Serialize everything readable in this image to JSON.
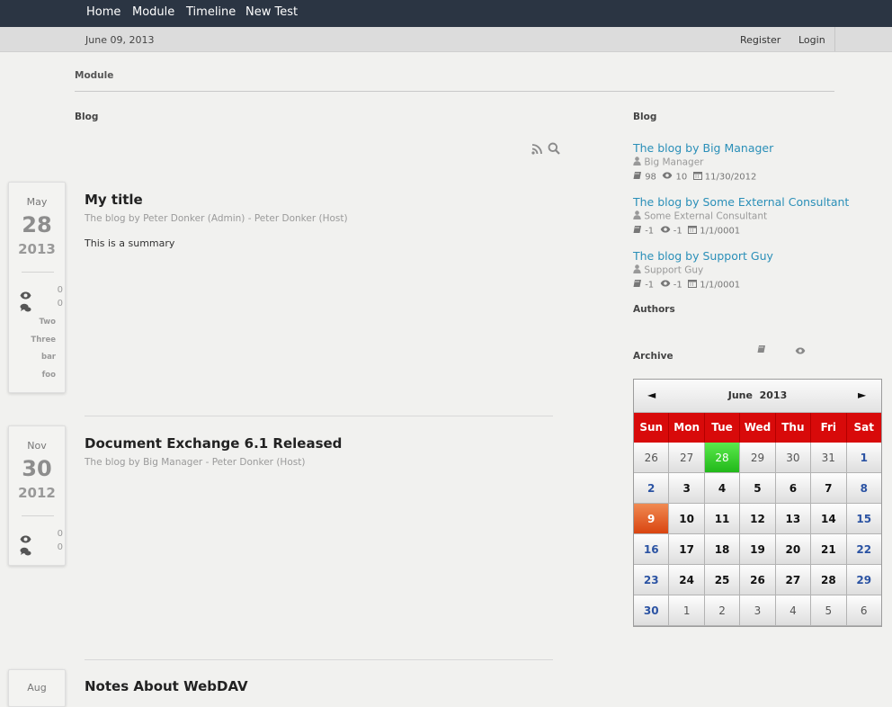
{
  "topnav": {
    "items": [
      "Home",
      "Module",
      "Timeline",
      "New Test"
    ]
  },
  "subbar": {
    "date": "June 09, 2013",
    "register": "Register",
    "login": "Login"
  },
  "breadcrumb": "Module",
  "main": {
    "section_title": "Blog",
    "posts": [
      {
        "month": "May",
        "day": "28",
        "year": "2013",
        "views": "0",
        "comments": "0",
        "tags": [
          "Two",
          "Three",
          "bar",
          "foo"
        ],
        "title": "My title",
        "subtitle": "The blog by Peter Donker (Admin) - Peter Donker (Host)",
        "summary": "This is a summary"
      },
      {
        "month": "Nov",
        "day": "30",
        "year": "2012",
        "views": "0",
        "comments": "0",
        "title": "Document Exchange 6.1 Released",
        "subtitle": "The blog by Big Manager - Peter Donker (Host)"
      },
      {
        "month": "Aug",
        "title": "Notes About WebDAV"
      }
    ]
  },
  "sidebar": {
    "blog_title": "Blog",
    "blogs": [
      {
        "name": "The blog by Big Manager",
        "author": "Big Manager",
        "posts": "98",
        "views": "10",
        "date": "11/30/2012"
      },
      {
        "name": "The blog by Some External Consultant",
        "author": "Some External Consultant",
        "posts": "-1",
        "views": "-1",
        "date": "1/1/0001"
      },
      {
        "name": "The blog by Support Guy",
        "author": "Support Guy",
        "posts": "-1",
        "views": "-1",
        "date": "1/1/0001"
      }
    ],
    "authors_title": "Authors",
    "archive_title": "Archive"
  },
  "calendar": {
    "prev": "◄",
    "next": "►",
    "month": "June",
    "year": "2013",
    "weekdays": [
      "Sun",
      "Mon",
      "Tue",
      "Wed",
      "Thu",
      "Fri",
      "Sat"
    ],
    "weeks": [
      [
        "26",
        "27",
        "28",
        "29",
        "30",
        "31",
        "1"
      ],
      [
        "2",
        "3",
        "4",
        "5",
        "6",
        "7",
        "8"
      ],
      [
        "9",
        "10",
        "11",
        "12",
        "13",
        "14",
        "15"
      ],
      [
        "16",
        "17",
        "18",
        "19",
        "20",
        "21",
        "22"
      ],
      [
        "23",
        "24",
        "25",
        "26",
        "27",
        "28",
        "29"
      ],
      [
        "30",
        "1",
        "2",
        "3",
        "4",
        "5",
        "6"
      ]
    ],
    "highlight_green": "28",
    "highlight_orange": "9",
    "colors": {
      "header_red": "#d80a0a",
      "today_green": "#21b81a",
      "selected_orange": "#d94410",
      "weekend_blue": "#2b53a3",
      "link_blue": "#2a8fb8",
      "nav_bg": "#2b3543"
    }
  }
}
